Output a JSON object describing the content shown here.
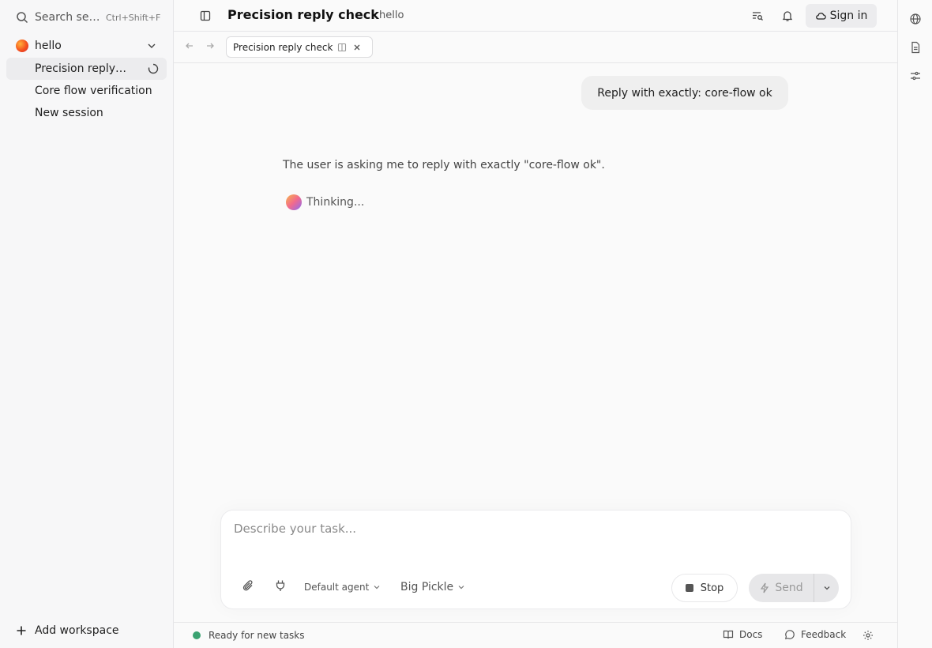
{
  "sidebar": {
    "search": {
      "placeholder": "Search se…",
      "shortcut": "Ctrl+Shift+F"
    },
    "workspace": {
      "name": "hello"
    },
    "sessions": [
      {
        "label": "Precision reply…",
        "active": true,
        "loading": true
      },
      {
        "label": "Core flow verification",
        "active": false
      },
      {
        "label": "New session",
        "active": false
      }
    ],
    "add_workspace_label": "Add workspace"
  },
  "header": {
    "title": "Precision reply check",
    "subtitle": "hello",
    "sign_in_label": "Sign in"
  },
  "tabs": [
    {
      "label": "Precision reply check"
    }
  ],
  "conversation": {
    "user_message": "Reply with exactly: core-flow ok",
    "assistant_reasoning": "The user is asking me to reply with exactly \"core-flow ok\".",
    "thinking_label": "Thinking..."
  },
  "composer": {
    "placeholder": "Describe your task...",
    "agent_label": "Default agent",
    "model_label": "Big Pickle",
    "stop_label": "Stop",
    "send_label": "Send"
  },
  "status_bar": {
    "status_text": "Ready for new tasks",
    "docs_label": "Docs",
    "feedback_label": "Feedback"
  },
  "icons": {
    "search": "search-icon",
    "chevron": "chevron-down-icon",
    "spinner": "spinner-icon",
    "plus": "plus-icon",
    "sidebar_toggle": "sidebar-toggle-icon",
    "list_search": "list-search-icon",
    "bell": "bell-icon",
    "cloud": "cloud-icon",
    "globe": "globe-icon",
    "file": "file-icon",
    "sliders": "sliders-icon",
    "paperclip": "paperclip-icon",
    "plug": "plug-icon",
    "bolt": "bolt-icon",
    "book": "book-icon",
    "message": "message-icon",
    "gear": "gear-icon"
  },
  "colors": {
    "status_ready": "#3aa271",
    "active_session_bg": "#ececee"
  }
}
